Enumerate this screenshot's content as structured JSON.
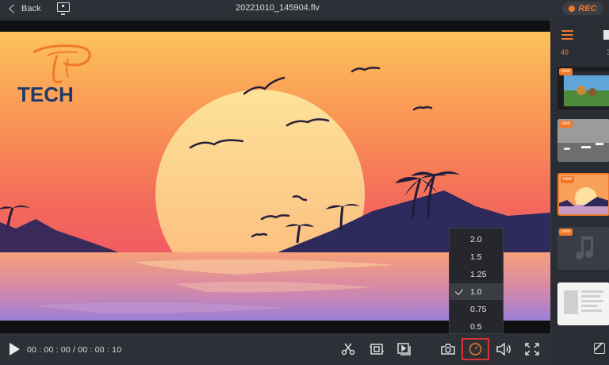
{
  "topbar": {
    "back_label": "Back",
    "title": "20221010_145904.flv",
    "rec_label": "REC"
  },
  "video": {
    "logo_text": "TECH"
  },
  "controls": {
    "timecode": "00 : 00 : 00 / 00 : 00 : 10",
    "icons": [
      "play-icon",
      "scissors-icon",
      "crop-icon",
      "playlist-play-icon",
      "camera-icon",
      "speedometer-icon",
      "volume-icon",
      "fullscreen-icon"
    ]
  },
  "speed_menu": {
    "options": [
      "2.0",
      "1.5",
      "1.25",
      "1.0",
      "0.75",
      "0.5"
    ],
    "selected": "1.0"
  },
  "sidebar": {
    "count": "49",
    "count_secondary": "3",
    "badge_label": "new",
    "thumbnails": [
      {
        "badge": "new",
        "kind": "game-scene"
      },
      {
        "badge": "new",
        "kind": "room-lights"
      },
      {
        "badge": "new",
        "kind": "sunset-selected"
      },
      {
        "badge": "new",
        "kind": "audio-file"
      },
      {
        "badge": "",
        "kind": "document"
      }
    ]
  },
  "colors": {
    "accent": "#f07a2a",
    "highlight_box": "#d9333a",
    "panel": "#2d3036"
  }
}
